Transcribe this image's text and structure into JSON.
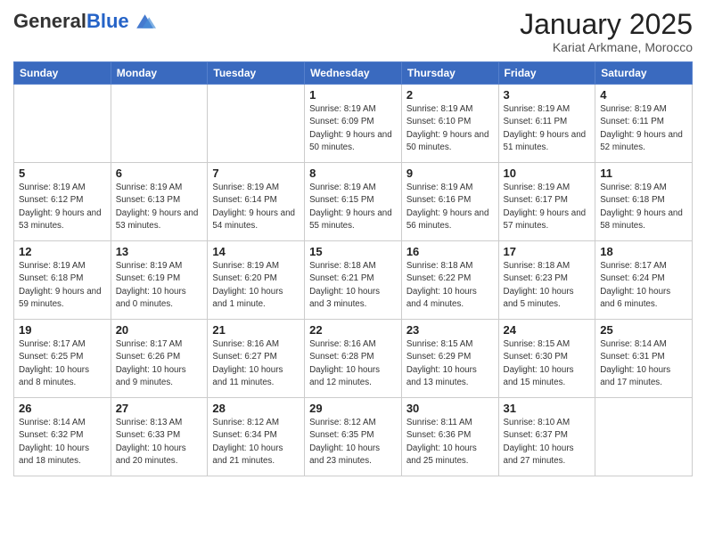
{
  "header": {
    "logo_general": "General",
    "logo_blue": "Blue",
    "month_title": "January 2025",
    "location": "Kariat Arkmane, Morocco"
  },
  "days_of_week": [
    "Sunday",
    "Monday",
    "Tuesday",
    "Wednesday",
    "Thursday",
    "Friday",
    "Saturday"
  ],
  "weeks": [
    [
      {
        "day": "",
        "info": ""
      },
      {
        "day": "",
        "info": ""
      },
      {
        "day": "",
        "info": ""
      },
      {
        "day": "1",
        "info": "Sunrise: 8:19 AM\nSunset: 6:09 PM\nDaylight: 9 hours\nand 50 minutes."
      },
      {
        "day": "2",
        "info": "Sunrise: 8:19 AM\nSunset: 6:10 PM\nDaylight: 9 hours\nand 50 minutes."
      },
      {
        "day": "3",
        "info": "Sunrise: 8:19 AM\nSunset: 6:11 PM\nDaylight: 9 hours\nand 51 minutes."
      },
      {
        "day": "4",
        "info": "Sunrise: 8:19 AM\nSunset: 6:11 PM\nDaylight: 9 hours\nand 52 minutes."
      }
    ],
    [
      {
        "day": "5",
        "info": "Sunrise: 8:19 AM\nSunset: 6:12 PM\nDaylight: 9 hours\nand 53 minutes."
      },
      {
        "day": "6",
        "info": "Sunrise: 8:19 AM\nSunset: 6:13 PM\nDaylight: 9 hours\nand 53 minutes."
      },
      {
        "day": "7",
        "info": "Sunrise: 8:19 AM\nSunset: 6:14 PM\nDaylight: 9 hours\nand 54 minutes."
      },
      {
        "day": "8",
        "info": "Sunrise: 8:19 AM\nSunset: 6:15 PM\nDaylight: 9 hours\nand 55 minutes."
      },
      {
        "day": "9",
        "info": "Sunrise: 8:19 AM\nSunset: 6:16 PM\nDaylight: 9 hours\nand 56 minutes."
      },
      {
        "day": "10",
        "info": "Sunrise: 8:19 AM\nSunset: 6:17 PM\nDaylight: 9 hours\nand 57 minutes."
      },
      {
        "day": "11",
        "info": "Sunrise: 8:19 AM\nSunset: 6:18 PM\nDaylight: 9 hours\nand 58 minutes."
      }
    ],
    [
      {
        "day": "12",
        "info": "Sunrise: 8:19 AM\nSunset: 6:18 PM\nDaylight: 9 hours\nand 59 minutes."
      },
      {
        "day": "13",
        "info": "Sunrise: 8:19 AM\nSunset: 6:19 PM\nDaylight: 10 hours\nand 0 minutes."
      },
      {
        "day": "14",
        "info": "Sunrise: 8:19 AM\nSunset: 6:20 PM\nDaylight: 10 hours\nand 1 minute."
      },
      {
        "day": "15",
        "info": "Sunrise: 8:18 AM\nSunset: 6:21 PM\nDaylight: 10 hours\nand 3 minutes."
      },
      {
        "day": "16",
        "info": "Sunrise: 8:18 AM\nSunset: 6:22 PM\nDaylight: 10 hours\nand 4 minutes."
      },
      {
        "day": "17",
        "info": "Sunrise: 8:18 AM\nSunset: 6:23 PM\nDaylight: 10 hours\nand 5 minutes."
      },
      {
        "day": "18",
        "info": "Sunrise: 8:17 AM\nSunset: 6:24 PM\nDaylight: 10 hours\nand 6 minutes."
      }
    ],
    [
      {
        "day": "19",
        "info": "Sunrise: 8:17 AM\nSunset: 6:25 PM\nDaylight: 10 hours\nand 8 minutes."
      },
      {
        "day": "20",
        "info": "Sunrise: 8:17 AM\nSunset: 6:26 PM\nDaylight: 10 hours\nand 9 minutes."
      },
      {
        "day": "21",
        "info": "Sunrise: 8:16 AM\nSunset: 6:27 PM\nDaylight: 10 hours\nand 11 minutes."
      },
      {
        "day": "22",
        "info": "Sunrise: 8:16 AM\nSunset: 6:28 PM\nDaylight: 10 hours\nand 12 minutes."
      },
      {
        "day": "23",
        "info": "Sunrise: 8:15 AM\nSunset: 6:29 PM\nDaylight: 10 hours\nand 13 minutes."
      },
      {
        "day": "24",
        "info": "Sunrise: 8:15 AM\nSunset: 6:30 PM\nDaylight: 10 hours\nand 15 minutes."
      },
      {
        "day": "25",
        "info": "Sunrise: 8:14 AM\nSunset: 6:31 PM\nDaylight: 10 hours\nand 17 minutes."
      }
    ],
    [
      {
        "day": "26",
        "info": "Sunrise: 8:14 AM\nSunset: 6:32 PM\nDaylight: 10 hours\nand 18 minutes."
      },
      {
        "day": "27",
        "info": "Sunrise: 8:13 AM\nSunset: 6:33 PM\nDaylight: 10 hours\nand 20 minutes."
      },
      {
        "day": "28",
        "info": "Sunrise: 8:12 AM\nSunset: 6:34 PM\nDaylight: 10 hours\nand 21 minutes."
      },
      {
        "day": "29",
        "info": "Sunrise: 8:12 AM\nSunset: 6:35 PM\nDaylight: 10 hours\nand 23 minutes."
      },
      {
        "day": "30",
        "info": "Sunrise: 8:11 AM\nSunset: 6:36 PM\nDaylight: 10 hours\nand 25 minutes."
      },
      {
        "day": "31",
        "info": "Sunrise: 8:10 AM\nSunset: 6:37 PM\nDaylight: 10 hours\nand 27 minutes."
      },
      {
        "day": "",
        "info": ""
      }
    ]
  ]
}
